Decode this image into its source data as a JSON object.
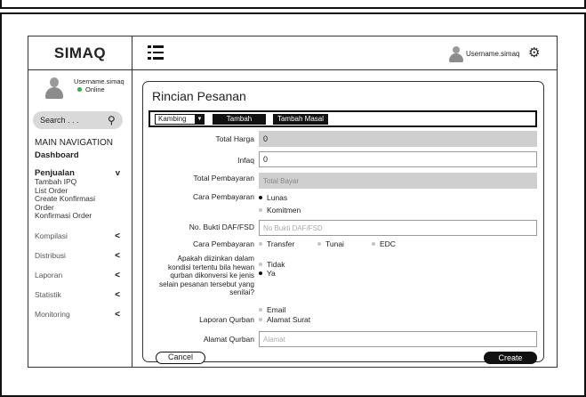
{
  "app": {
    "brand": "SIMAQ"
  },
  "user": {
    "name": "Username.simaq",
    "status": "Online"
  },
  "topbar": {
    "username": "Username.simaq"
  },
  "search": {
    "placeholder": "Search . . ."
  },
  "nav": {
    "heading": "MAIN NAVIGATION",
    "dashboard": "Dashboard",
    "penjualan": {
      "label": "Penjualan",
      "toggle": "v",
      "items": [
        "Tambah IPQ",
        "List Order",
        "Create Konfirmasi Order",
        "Konfirmasi Order"
      ]
    },
    "items": [
      {
        "label": "Kompilasi",
        "arrow": "<"
      },
      {
        "label": "Distribusi",
        "arrow": "<"
      },
      {
        "label": "Laporan",
        "arrow": "<"
      },
      {
        "label": "Statistik",
        "arrow": "<"
      },
      {
        "label": "Monitoring",
        "arrow": "<"
      }
    ]
  },
  "form": {
    "title": "Rincian Pesanan",
    "toolbar": {
      "select_value": "Kambing",
      "add_label": "Tambah",
      "add_bulk_label": "Tambah Masal"
    },
    "total_harga": {
      "label": "Total Harga",
      "value": "0"
    },
    "infaq": {
      "label": "Infaq",
      "value": "0"
    },
    "total_pembayaran": {
      "label": "Total Pembayaran",
      "placeholder": "Total Bayar"
    },
    "cara_pembayaran_1": {
      "label": "Cara Pembayaran",
      "options": [
        "Lunas",
        "Komitmen"
      ]
    },
    "no_bukti": {
      "label": "No. Bukti DAF/FSD",
      "placeholder": "No Bukti DAF/FSD"
    },
    "cara_pembayaran_2": {
      "label": "Cara Pembayaran",
      "options": [
        "Transfer",
        "Tunai",
        "EDC"
      ]
    },
    "konversi": {
      "label": "Apakah diizinkan dalam kondisi tertentu bila hewan qurban dikonversi ke jenis selain pesanan tersebut yang senilai?",
      "options": [
        "Tidak",
        "Ya"
      ]
    },
    "laporan_qurban": {
      "label": "Laporan Qurban",
      "options": [
        "Email",
        "Alamat Surat"
      ]
    },
    "alamat_qurban": {
      "label": "Alamat Qurban",
      "placeholder": "Alamat"
    },
    "cancel_label": "Cancel",
    "create_label": "Create"
  }
}
